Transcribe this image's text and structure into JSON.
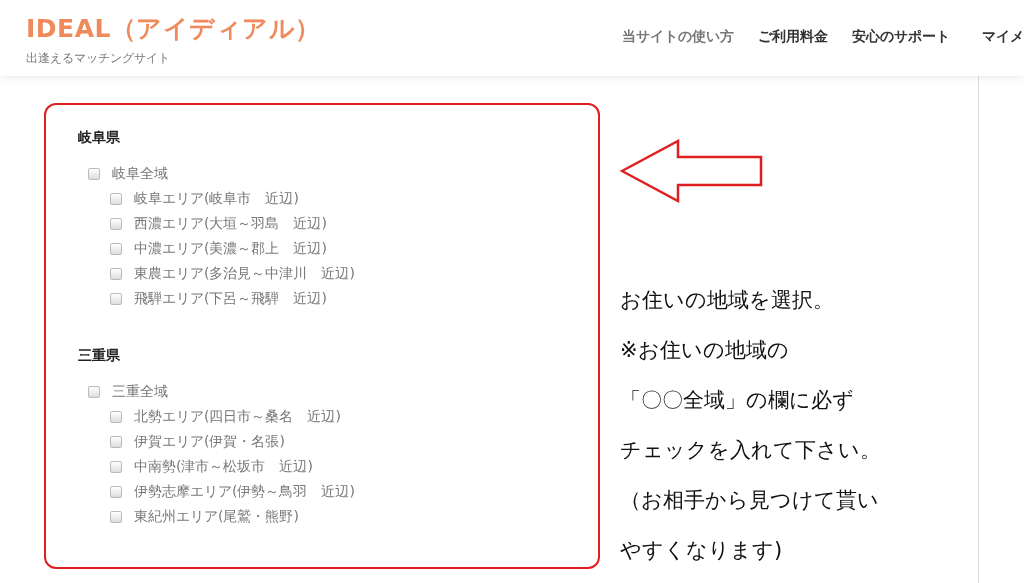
{
  "header": {
    "logo": "IDEAL（アイディアル）",
    "tagline": "出逢えるマッチングサイト",
    "nav": [
      "当サイトの使い方",
      "ご利用料金",
      "安心のサポート",
      "マイメ"
    ]
  },
  "prefectures": [
    {
      "name": "岐阜県",
      "all": {
        "label": "岐阜全域",
        "checked": false
      },
      "areas": [
        {
          "label": "岐阜エリア(岐阜市　近辺)",
          "checked": false
        },
        {
          "label": "西濃エリア(大垣～羽島　近辺)",
          "checked": false
        },
        {
          "label": "中濃エリア(美濃～郡上　近辺)",
          "checked": false
        },
        {
          "label": "東農エリア(多治見～中津川　近辺)",
          "checked": false
        },
        {
          "label": "飛騨エリア(下呂～飛騨　近辺)",
          "checked": false
        }
      ]
    },
    {
      "name": "三重県",
      "all": {
        "label": "三重全域",
        "checked": false
      },
      "areas": [
        {
          "label": "北勢エリア(四日市～桑名　近辺)",
          "checked": false
        },
        {
          "label": "伊賀エリア(伊賀・名張)",
          "checked": false
        },
        {
          "label": "中南勢(津市～松坂市　近辺)",
          "checked": false
        },
        {
          "label": "伊勢志摩エリア(伊勢～鳥羽　近辺)",
          "checked": false
        },
        {
          "label": "東紀州エリア(尾鷲・熊野)",
          "checked": false
        }
      ]
    }
  ],
  "note": [
    "お住いの地域を選択。",
    "※お住いの地域の",
    "「〇〇全域」の欄に必ず",
    "チェックを入れて下さい。",
    "（お相手から見つけて貰い",
    "やすくなります)"
  ]
}
